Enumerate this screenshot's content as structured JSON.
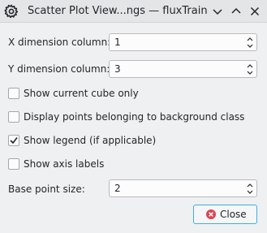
{
  "window": {
    "title": "Scatter Plot View...ngs — fluxTrainer"
  },
  "fields": [
    {
      "label": "X dimension column:",
      "value": "1"
    },
    {
      "label": "Y dimension column:",
      "value": "3"
    },
    {
      "label": "Base point size:",
      "value": "2"
    }
  ],
  "options": [
    {
      "label": "Show current cube only",
      "checked": false
    },
    {
      "label": "Display points belonging to background class",
      "checked": false
    },
    {
      "label": "Show legend (if applicable)",
      "checked": true
    },
    {
      "label": "Show axis labels",
      "checked": false
    }
  ],
  "close_button": {
    "label": "Close"
  },
  "icons": {
    "app": "gear-icon",
    "titlebar": [
      "chevron-down-icon",
      "chevron-up-icon",
      "close-icon"
    ],
    "close": "close-circle-icon"
  },
  "colors": {
    "accent": "#3daee9",
    "close_icon": "#da4453"
  }
}
